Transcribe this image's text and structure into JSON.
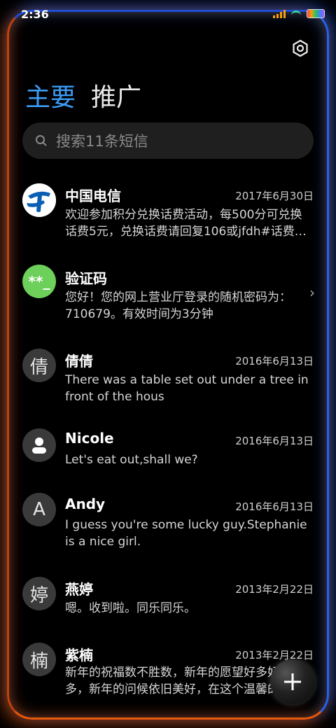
{
  "status": {
    "time": "2:36"
  },
  "tabs": [
    {
      "label": "主要",
      "active": true
    },
    {
      "label": "推广",
      "active": false
    }
  ],
  "search": {
    "placeholder": "搜索11条短信"
  },
  "conversations": [
    {
      "name": "中国电信",
      "date": "2017年6月30日",
      "preview": "欢迎参加积分兑换话费活动，每500分可兑换话费5元，兑换话费请回复106或jfdh#话费…",
      "avatar": "telecom-logo"
    },
    {
      "name": "验证码",
      "date": "",
      "preview": "您好！您的网上营业厅登录的随机密码为：710679。有效时间为3分钟",
      "avatar": "**_"
    },
    {
      "name": "倩倩",
      "date": "2016年6月13日",
      "preview": "There was a table set out under a tree in front of the hous",
      "avatar": "倩"
    },
    {
      "name": "Nicole",
      "date": "2016年6月13日",
      "preview": "Let's eat out,shall we?",
      "avatar": "person-icon"
    },
    {
      "name": "Andy",
      "date": "2016年6月13日",
      "preview": "I guess you're some lucky guy.Stephanie is a nice girl.",
      "avatar": "A"
    },
    {
      "name": "燕婷",
      "date": "2013年2月22日",
      "preview": "嗯。收到啦。同乐同乐。",
      "avatar": "婷"
    },
    {
      "name": "紫楠",
      "date": "2013年2月22日",
      "preview": "新年的祝福数不胜数，新年的愿望好多好多，新年的问候依旧美好，在这个温馨的时刻",
      "avatar": "楠"
    }
  ],
  "colors": {
    "accent": "#3b9df7",
    "verify_avatar": "#6dd05a",
    "telecom": "#0a5fb4"
  }
}
